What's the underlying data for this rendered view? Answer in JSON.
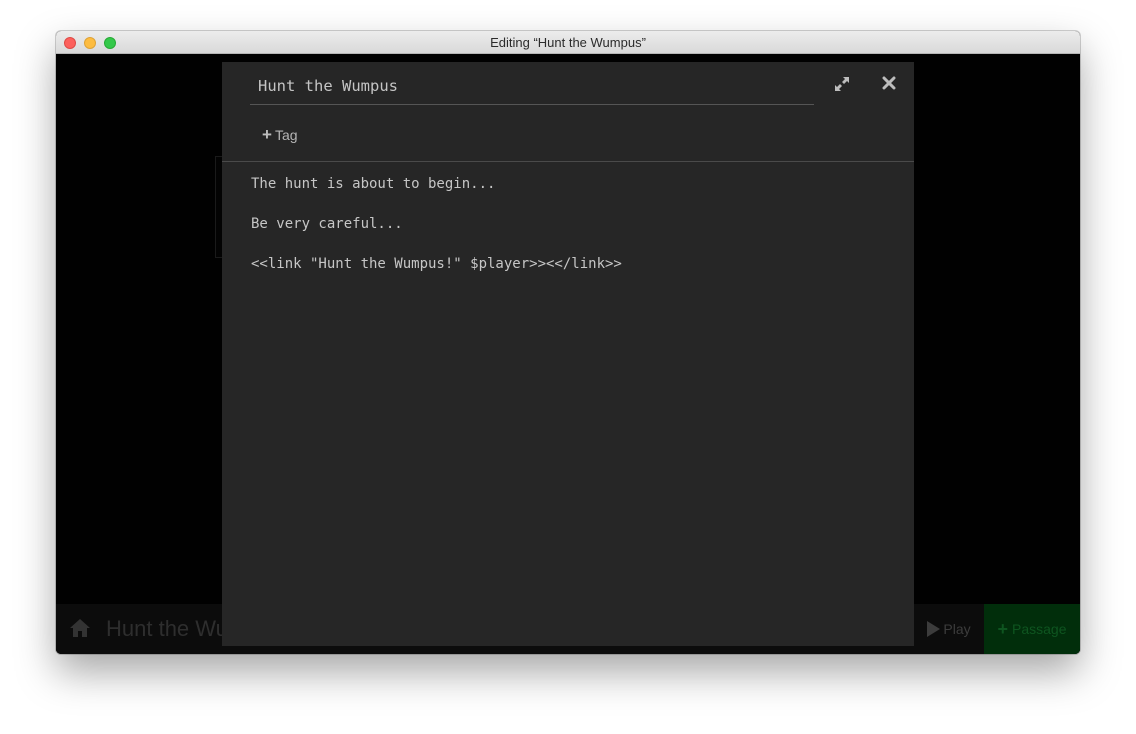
{
  "window": {
    "title": "Editing “Hunt the Wumpus”"
  },
  "background": {
    "story_title": "Hunt the Wumpus",
    "play_label": "Play",
    "passage_label": "Passage"
  },
  "dialog": {
    "passage_name": "Hunt the Wumpus",
    "tag_label": "Tag",
    "text_lines": [
      "The hunt is about to begin...",
      "Be very careful...",
      "<<link \"Hunt the Wumpus!\" $player>><</link>>"
    ],
    "icons": {
      "expand": "expand-icon",
      "close": "close-icon",
      "home": "home-icon",
      "play": "play-icon",
      "plus": "plus-icon"
    }
  },
  "colors": {
    "dialog_bg": "#262626",
    "passage_button_bg": "#012e0b"
  }
}
